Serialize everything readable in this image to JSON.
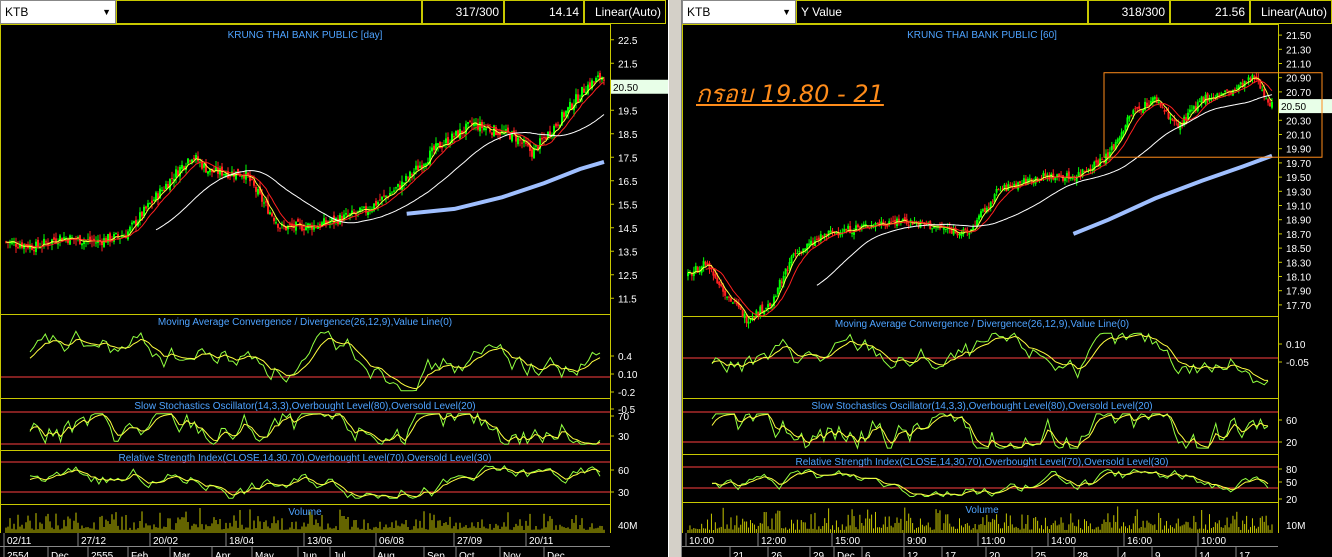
{
  "left": {
    "symbol": "KTB",
    "value_label": "",
    "counter": "317/300",
    "last_value": "14.14",
    "scale_mode": "Linear(Auto)",
    "price_title": "KRUNG THAI BANK PUBLIC [day]",
    "price_axis": [
      "22.5",
      "21.5",
      "20.5",
      "19.5",
      "18.5",
      "17.5",
      "16.5",
      "15.5",
      "14.5",
      "13.5",
      "12.5",
      "11.5"
    ],
    "price_tag": "20.50",
    "macd_title": "Moving Average Convergence / Divergence(26,12,9),Value Line(0)",
    "macd_axis": [
      "0.4",
      "0.10",
      "-0.2",
      "-0.5"
    ],
    "stoch_title": "Slow Stochastics Oscillator(14,3,3),Overbought Level(80),Oversold Level(20)",
    "stoch_axis": [
      "70",
      "30"
    ],
    "rsi_title": "Relative Strength Index(CLOSE,14,30,70),Overbought Level(70),Oversold Level(30)",
    "rsi_axis": [
      "60",
      "30"
    ],
    "volume_title": "Volume",
    "volume_axis": "40M",
    "date_row1": [
      "02/11",
      "27/12",
      "20/02",
      "18/04",
      "13/06",
      "06/08",
      "27/09",
      "20/11"
    ],
    "date_row2": [
      "2554",
      "Dec",
      "2555",
      "Feb",
      "Mar",
      "Apr",
      "May",
      "Jun",
      "Jul",
      "Aug",
      "Sep",
      "Oct",
      "Nov",
      "Dec"
    ]
  },
  "right": {
    "symbol": "KTB",
    "value_label": "Y Value",
    "counter": "318/300",
    "last_value": "21.56",
    "scale_mode": "Linear(Auto)",
    "price_title": "KRUNG THAI BANK PUBLIC [60]",
    "price_axis": [
      "21.50",
      "21.30",
      "21.10",
      "20.90",
      "20.70",
      "20.50",
      "20.30",
      "20.10",
      "19.90",
      "19.70",
      "19.50",
      "19.30",
      "19.10",
      "18.90",
      "18.70",
      "18.50",
      "18.30",
      "18.10",
      "17.90",
      "17.70"
    ],
    "price_tag": "20.50",
    "annotation": "กรอบ 19.80 - 21",
    "macd_title": "Moving Average Convergence / Divergence(26,12,9),Value Line(0)",
    "macd_axis": [
      "0.10",
      "-0.05"
    ],
    "stoch_title": "Slow Stochastics Oscillator(14,3,3),Overbought Level(80),Oversold Level(20)",
    "stoch_axis": [
      "60",
      "20"
    ],
    "rsi_title": "Relative Strength Index(CLOSE,14,30,70),Overbought Level(70),Oversold Level(30)",
    "rsi_axis": [
      "80",
      "50",
      "20"
    ],
    "volume_title": "Volume",
    "volume_axis": "10M",
    "date_row1": [
      "10:00",
      "12:00",
      "15:00",
      "9:00",
      "11:00",
      "14:00",
      "16:00",
      "10:00"
    ],
    "date_row2": [
      "21",
      "26",
      "29",
      "Dec",
      "6",
      "12",
      "17",
      "20",
      "25",
      "28",
      "4",
      "9",
      "14",
      "17"
    ]
  },
  "colors": {
    "frame": "#c8c800",
    "title": "#4ea3ff",
    "candle_up": "#00ff00",
    "candle_down": "#ff2020",
    "ma_red": "#ff2020",
    "ma_white": "#ffffff",
    "ma_blue": "#9fbfff",
    "osc_green": "#90ff40",
    "osc_yellow": "#ffff40",
    "level_line": "#ff4040",
    "annotation": "#ff8c1a"
  },
  "chart_data": [
    {
      "type": "candlestick",
      "title": "KRUNG THAI BANK PUBLIC [day]",
      "ylim": [
        11.0,
        23.0
      ],
      "x_ticks": [
        "02/11",
        "27/12",
        "20/02",
        "18/04",
        "13/06",
        "06/08",
        "27/09",
        "20/11"
      ],
      "close_path": [
        [
          0,
          13.9
        ],
        [
          0.05,
          13.7
        ],
        [
          0.09,
          14.1
        ],
        [
          0.15,
          13.9
        ],
        [
          0.2,
          14.2
        ],
        [
          0.25,
          15.8
        ],
        [
          0.31,
          17.6
        ],
        [
          0.34,
          16.9
        ],
        [
          0.4,
          16.8
        ],
        [
          0.43,
          15.6
        ],
        [
          0.46,
          14.5
        ],
        [
          0.52,
          14.6
        ],
        [
          0.6,
          15.2
        ],
        [
          0.66,
          16.3
        ],
        [
          0.72,
          17.9
        ],
        [
          0.78,
          18.9
        ],
        [
          0.85,
          18.4
        ],
        [
          0.88,
          17.7
        ],
        [
          0.92,
          18.9
        ],
        [
          0.97,
          20.5
        ],
        [
          1.0,
          21.0
        ]
      ],
      "last": 20.5
    },
    {
      "type": "candlestick",
      "title": "KRUNG THAI BANK PUBLIC [60]",
      "ylim": [
        17.6,
        21.6
      ],
      "x_ticks": [
        "10:00",
        "12:00",
        "15:00",
        "9:00",
        "11:00",
        "14:00",
        "16:00",
        "10:00"
      ],
      "close_path": [
        [
          0,
          18.1
        ],
        [
          0.03,
          18.3
        ],
        [
          0.07,
          17.8
        ],
        [
          0.1,
          17.5
        ],
        [
          0.14,
          17.7
        ],
        [
          0.18,
          18.4
        ],
        [
          0.24,
          18.7
        ],
        [
          0.3,
          18.8
        ],
        [
          0.36,
          18.9
        ],
        [
          0.42,
          18.8
        ],
        [
          0.48,
          18.7
        ],
        [
          0.53,
          19.3
        ],
        [
          0.6,
          19.5
        ],
        [
          0.66,
          19.5
        ],
        [
          0.72,
          19.8
        ],
        [
          0.76,
          20.4
        ],
        [
          0.8,
          20.6
        ],
        [
          0.84,
          20.2
        ],
        [
          0.88,
          20.6
        ],
        [
          0.93,
          20.7
        ],
        [
          0.97,
          20.9
        ],
        [
          1.0,
          20.5
        ]
      ],
      "last": 20.5
    }
  ]
}
